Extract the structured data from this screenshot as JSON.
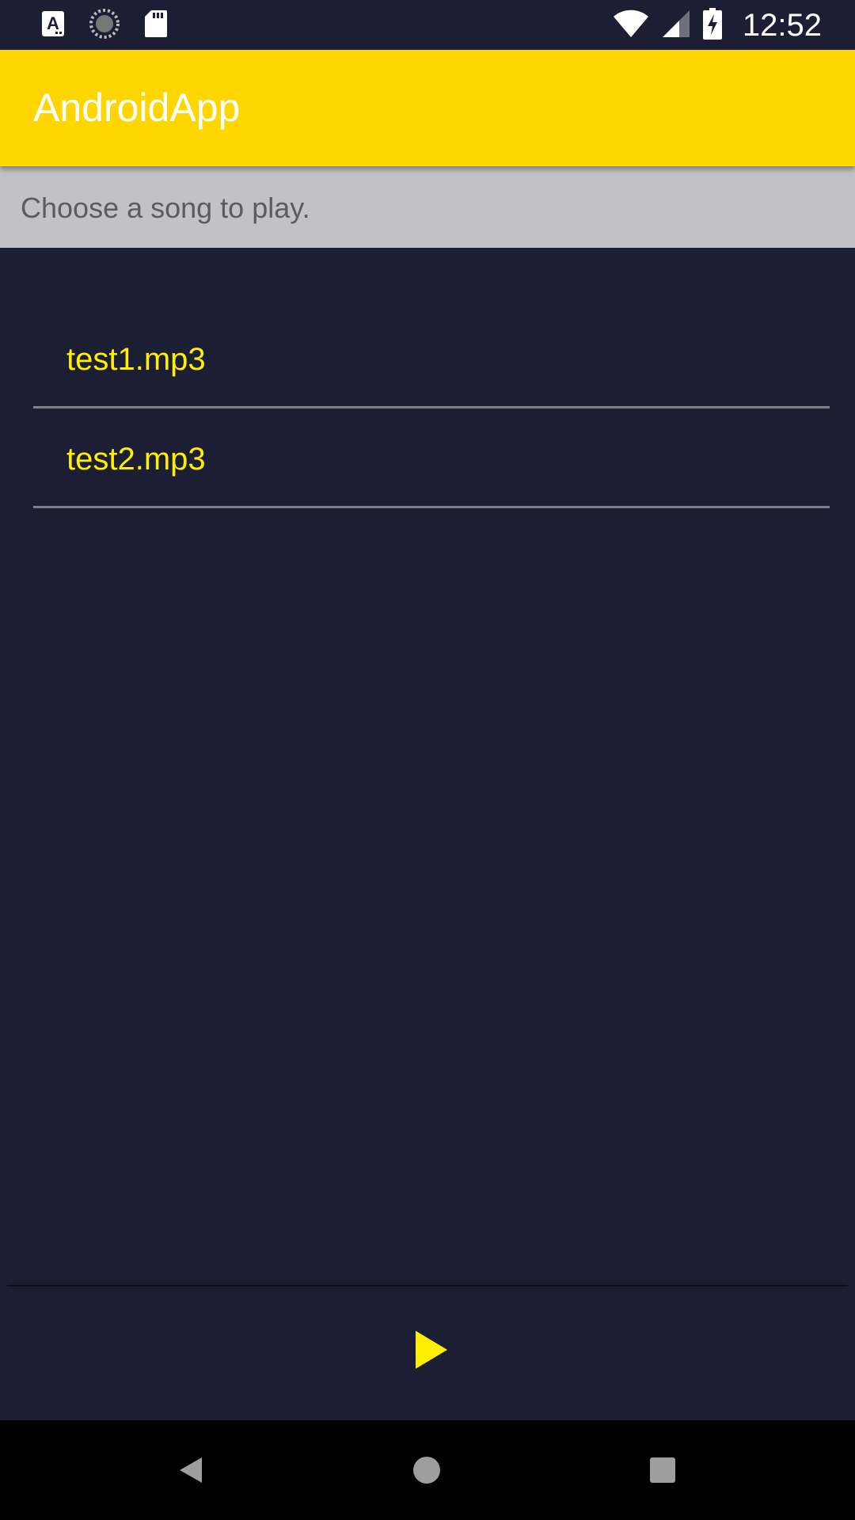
{
  "status_bar": {
    "time": "12:52",
    "left_icons": [
      "font-a-icon",
      "loading-circle-icon",
      "sd-card-icon"
    ],
    "right_icons": [
      "wifi-icon",
      "cell-signal-icon",
      "battery-charging-icon"
    ]
  },
  "app_bar": {
    "title": "AndroidApp",
    "color": "#ffd600"
  },
  "prompt": {
    "text": "Choose a song to play."
  },
  "songs": [
    {
      "label": "test1.mp3"
    },
    {
      "label": "test2.mp3"
    }
  ],
  "player": {
    "play_icon": "play-icon",
    "accent": "#ffef00"
  },
  "nav_bar": {
    "icons": [
      "back-icon",
      "home-icon",
      "recent-apps-icon"
    ]
  },
  "colors": {
    "background": "#1c1f33",
    "banner": "#c2c1c6",
    "song_text": "#ffef00"
  }
}
